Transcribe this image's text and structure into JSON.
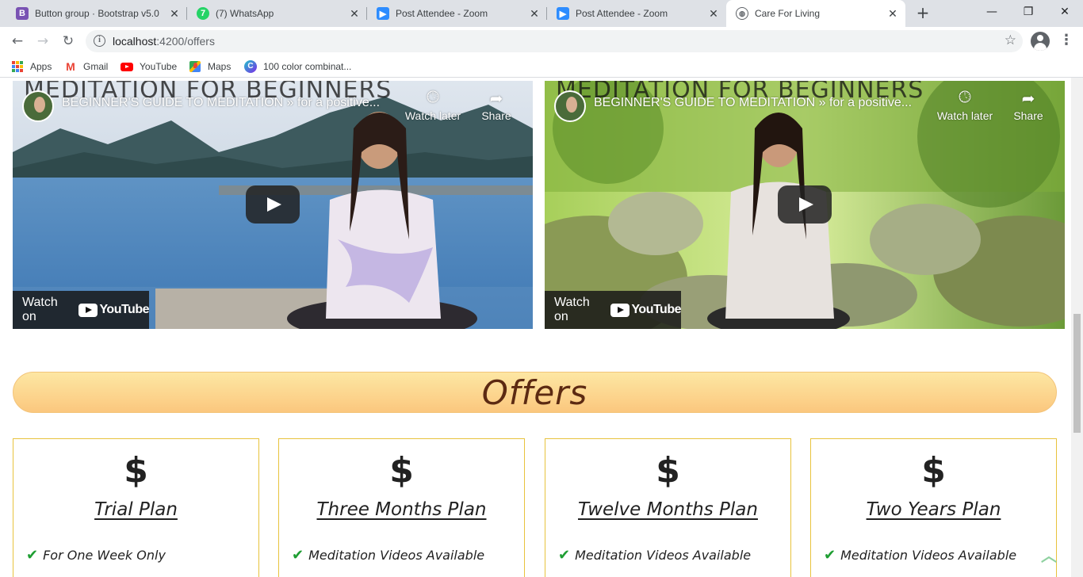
{
  "browser": {
    "tabs": [
      {
        "title": "Button group · Bootstrap v5.0",
        "favicon": "B",
        "favicon_color": "#7952b3"
      },
      {
        "title": "(7) WhatsApp",
        "favicon": "7",
        "favicon_color": "#25d366"
      },
      {
        "title": "Post Attendee - Zoom",
        "favicon": "",
        "favicon_color": "#2d8cff"
      },
      {
        "title": "Post Attendee - Zoom",
        "favicon": "",
        "favicon_color": "#2d8cff"
      },
      {
        "title": "Care For Living",
        "favicon": "",
        "favicon_color": "#5f6368"
      }
    ],
    "url_host": "localhost",
    "url_rest": ":4200/offers",
    "bookmarks": [
      {
        "label": "Apps",
        "icon": "apps-grid-icon"
      },
      {
        "label": "Gmail",
        "icon": "gmail-icon"
      },
      {
        "label": "YouTube",
        "icon": "youtube-icon"
      },
      {
        "label": "Maps",
        "icon": "maps-icon"
      },
      {
        "label": "100 color combinat...",
        "icon": "canva-icon"
      }
    ]
  },
  "videos": [
    {
      "overlay_title": "MEDITATION FOR BEGINNERS",
      "title": "BEGINNER'S GUIDE TO MEDITATION » for a positive...",
      "watch_later": "Watch later",
      "share": "Share",
      "watch_on": "Watch on",
      "brand": "YouTube"
    },
    {
      "overlay_title": "MEDITATION FOR BEGINNERS",
      "title": "BEGINNER'S GUIDE TO MEDITATION » for a positive...",
      "watch_later": "Watch later",
      "share": "Share",
      "watch_on": "Watch on",
      "brand": "YouTube"
    }
  ],
  "offers": {
    "heading": "Offers",
    "plans": [
      {
        "icon": "$",
        "name": "Trial Plan",
        "feature": "For One Week Only"
      },
      {
        "icon": "$",
        "name": "Three Months Plan",
        "feature": "Meditation Videos Available"
      },
      {
        "icon": "$",
        "name": "Twelve Months Plan",
        "feature": "Meditation Videos Available"
      },
      {
        "icon": "$",
        "name": "Two Years Plan",
        "feature": "Meditation Videos Available"
      }
    ]
  },
  "colors": {
    "banner_top": "#fde7a3",
    "banner_bottom": "#fbc77e",
    "heading_text": "#5c2a12",
    "card_border": "#e8c33d",
    "check": "#1e9e32"
  }
}
